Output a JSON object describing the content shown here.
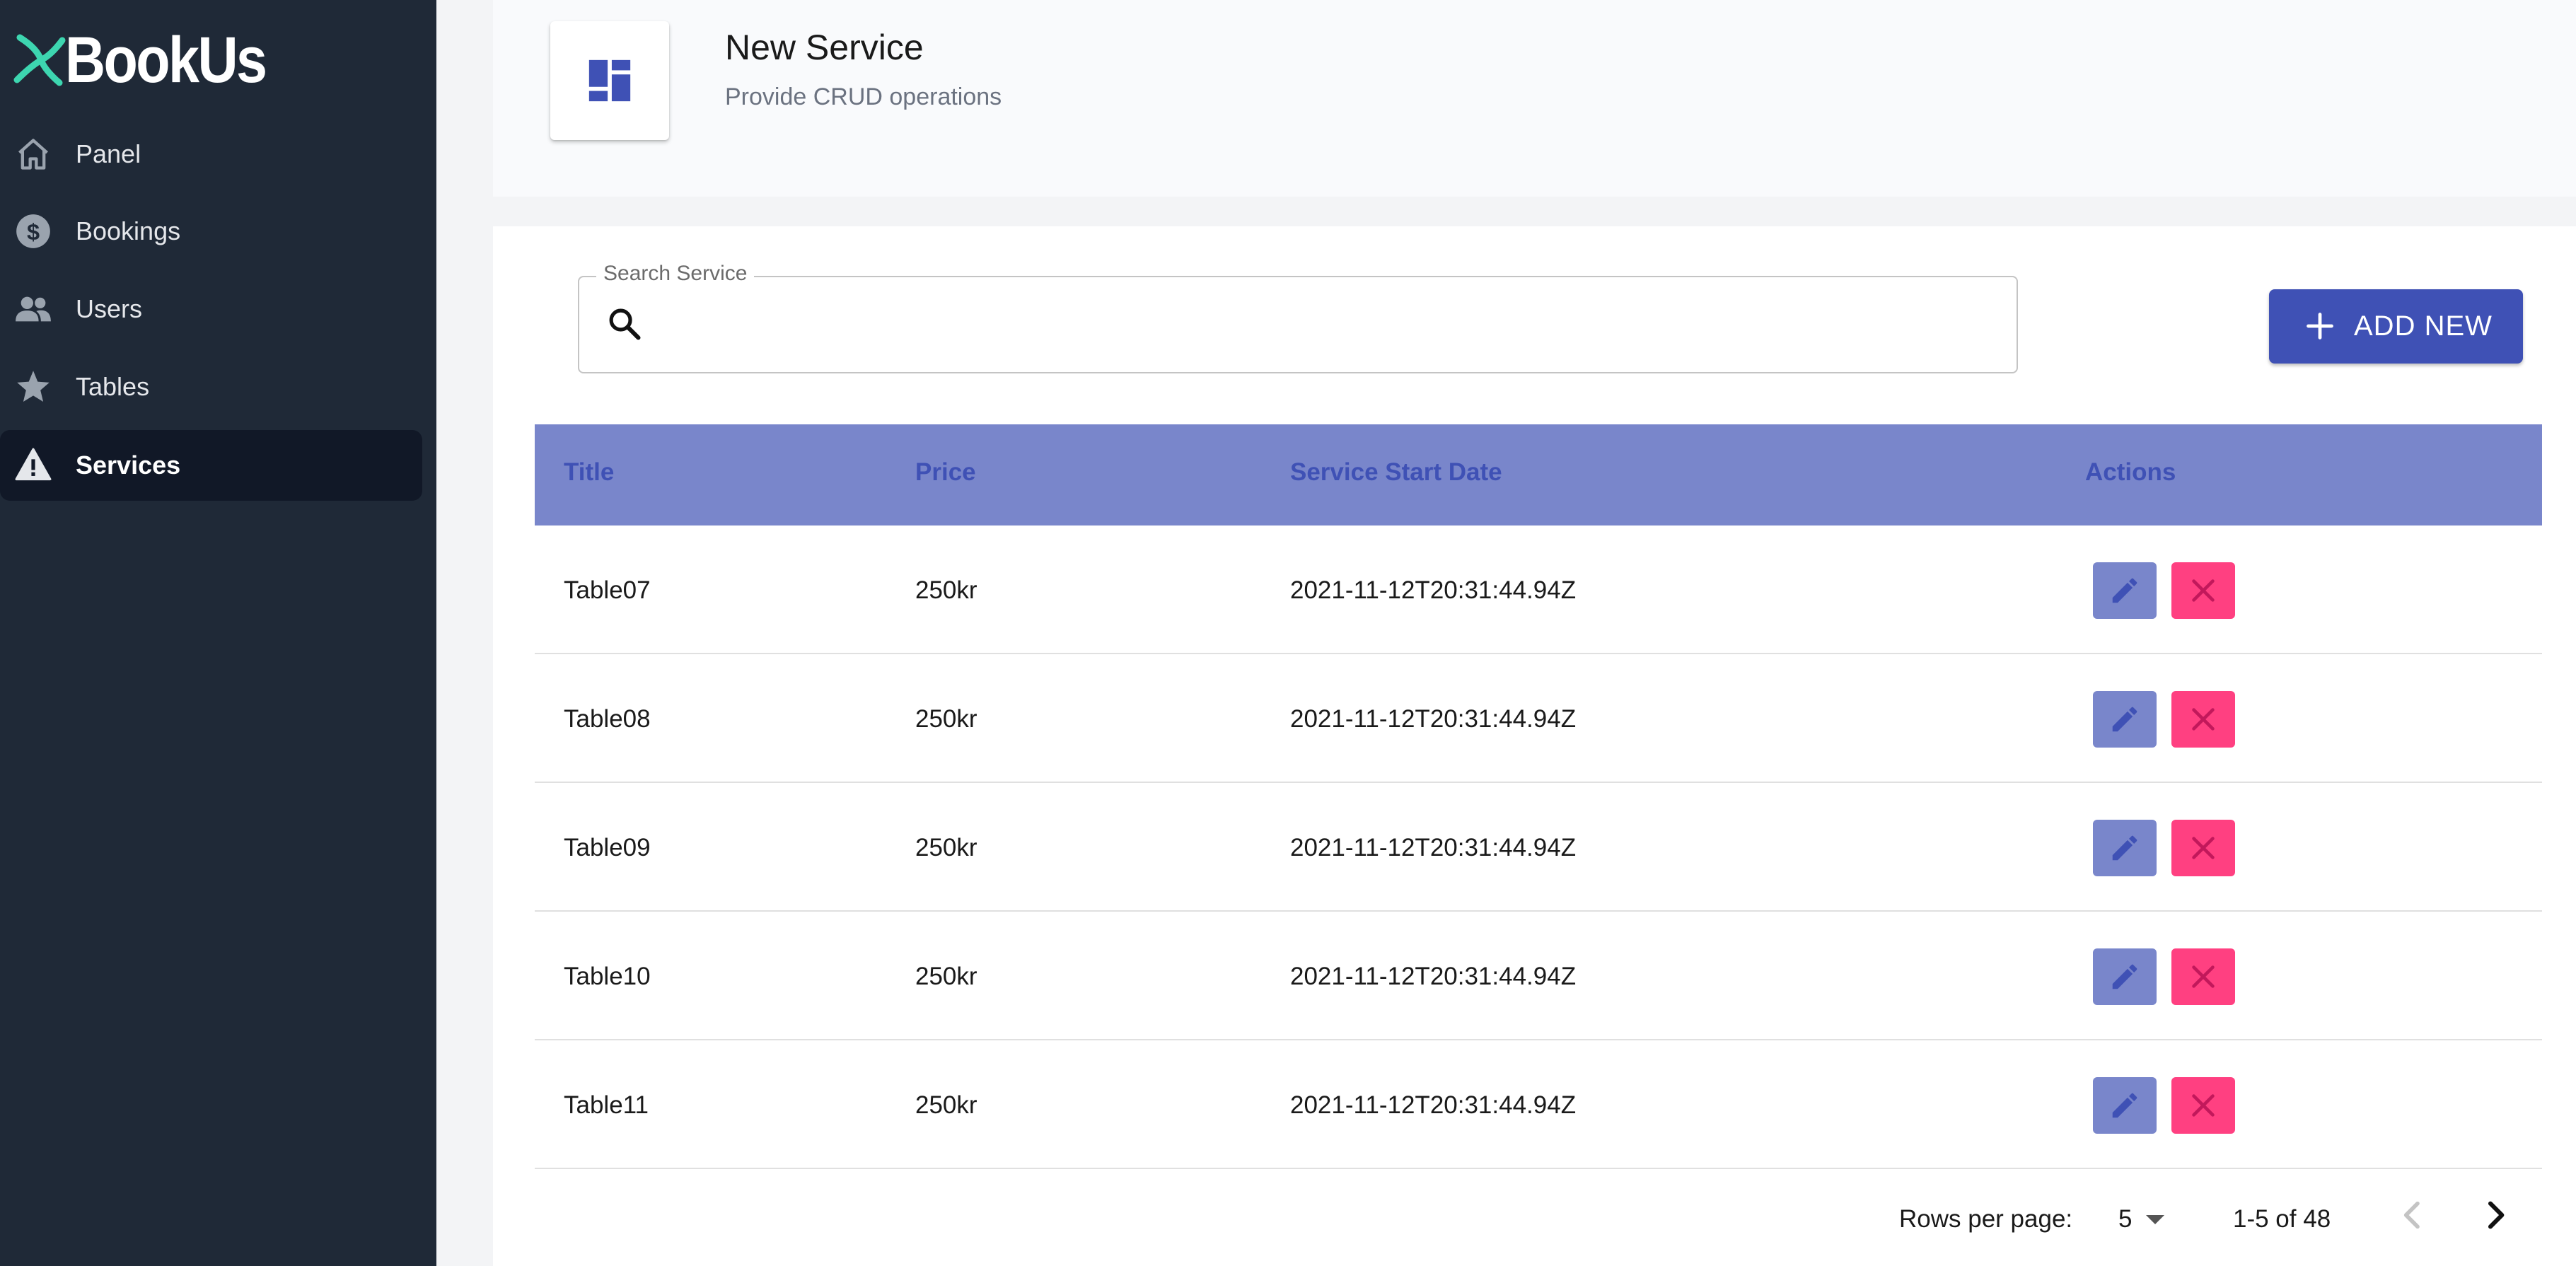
{
  "app": {
    "name": "BookUs"
  },
  "sidebar": {
    "items": [
      {
        "label": "Panel",
        "icon": "home-icon"
      },
      {
        "label": "Bookings",
        "icon": "dollar-circle-icon"
      },
      {
        "label": "Users",
        "icon": "users-icon"
      },
      {
        "label": "Tables",
        "icon": "star-icon"
      },
      {
        "label": "Services",
        "icon": "warning-icon",
        "active": true
      }
    ]
  },
  "header": {
    "title": "New Service",
    "subtitle": "Provide CRUD operations",
    "icon": "dashboard-icon"
  },
  "search": {
    "label": "Search Service",
    "value": "",
    "placeholder": ""
  },
  "add_button": {
    "label": "ADD NEW"
  },
  "table": {
    "columns": [
      "Title",
      "Price",
      "Service Start Date",
      "Actions"
    ],
    "rows": [
      {
        "title": "Table07",
        "price": "250kr",
        "start_date": "2021-11-12T20:31:44.94Z"
      },
      {
        "title": "Table08",
        "price": "250kr",
        "start_date": "2021-11-12T20:31:44.94Z"
      },
      {
        "title": "Table09",
        "price": "250kr",
        "start_date": "2021-11-12T20:31:44.94Z"
      },
      {
        "title": "Table10",
        "price": "250kr",
        "start_date": "2021-11-12T20:31:44.94Z"
      },
      {
        "title": "Table11",
        "price": "250kr",
        "start_date": "2021-11-12T20:31:44.94Z"
      }
    ]
  },
  "pagination": {
    "rows_per_page_label": "Rows per page:",
    "rows_per_page": "5",
    "range": "1-5 of 48"
  },
  "colors": {
    "sidebar_bg": "#1f2937",
    "sidebar_active": "#111827",
    "primary": "#3f51b5",
    "header_row": "#7986cb",
    "delete": "#ff4081",
    "logo_accent": "#3dd6b0"
  }
}
